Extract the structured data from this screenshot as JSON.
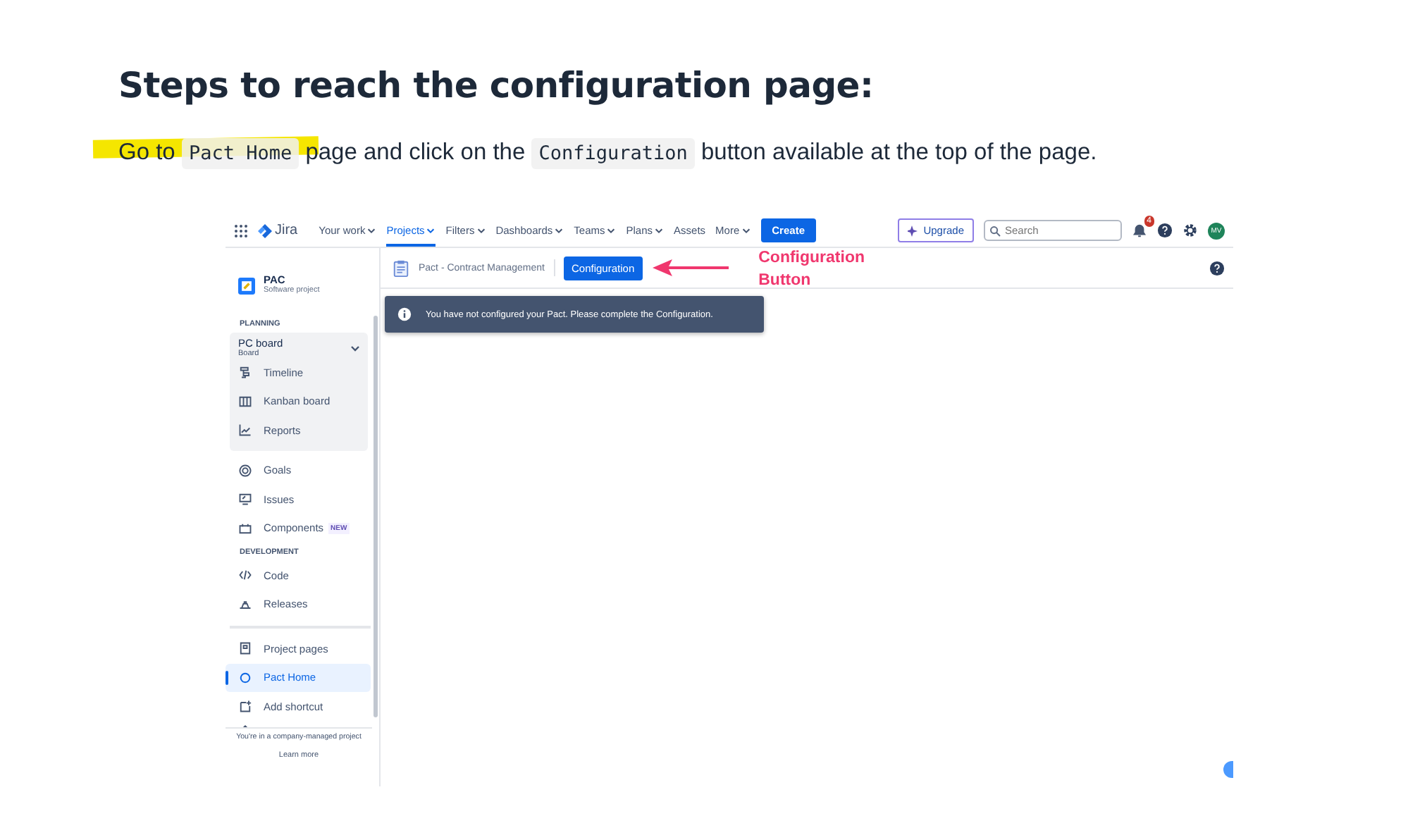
{
  "heading": "Steps to reach the configuration page:",
  "instruction": [
    {
      "kind": "text",
      "text": "Go to "
    },
    {
      "kind": "code",
      "text": "Pact Home"
    },
    {
      "kind": "text",
      "text": " page and click on the "
    },
    {
      "kind": "code",
      "text": "Configuration"
    },
    {
      "kind": "text",
      "text": " button available at the top of the page."
    }
  ],
  "screenshot": {
    "nav": {
      "logo": "Jira",
      "items": [
        {
          "label": "Your work",
          "dropdown": true,
          "selected": false
        },
        {
          "label": "Projects",
          "dropdown": true,
          "selected": true
        },
        {
          "label": "Filters",
          "dropdown": true,
          "selected": false
        },
        {
          "label": "Dashboards",
          "dropdown": true,
          "selected": false
        },
        {
          "label": "Teams",
          "dropdown": true,
          "selected": false
        },
        {
          "label": "Plans",
          "dropdown": true,
          "selected": false
        },
        {
          "label": "Assets",
          "dropdown": false,
          "selected": false
        },
        {
          "label": "More",
          "dropdown": true,
          "selected": false
        }
      ],
      "create": "Create",
      "upgrade": "Upgrade",
      "search": {
        "placeholder": "Search"
      },
      "notifications": "4",
      "avatar": "MV"
    },
    "project": {
      "name": "PAC",
      "type": "Software project"
    },
    "sidebar": [
      {
        "kind": "section",
        "label": "PLANNING"
      },
      {
        "kind": "group",
        "title": "PC board",
        "subtitle": "Board",
        "expanded": true,
        "children": [
          {
            "label": "Timeline",
            "selected": false
          },
          {
            "label": "Kanban board",
            "selected": false
          },
          {
            "label": "Reports",
            "selected": false
          }
        ]
      },
      {
        "kind": "item",
        "label": "Goals",
        "selected": false
      },
      {
        "kind": "item",
        "label": "Issues",
        "selected": false
      },
      {
        "kind": "item",
        "label": "Components",
        "badge": "NEW",
        "selected": false
      },
      {
        "kind": "section",
        "label": "DEVELOPMENT"
      },
      {
        "kind": "item",
        "label": "Code",
        "selected": false
      },
      {
        "kind": "item",
        "label": "Releases",
        "selected": false
      },
      {
        "kind": "divider"
      },
      {
        "kind": "item",
        "label": "Project pages",
        "selected": false
      },
      {
        "kind": "item",
        "label": "Pact Home",
        "selected": true
      },
      {
        "kind": "item",
        "label": "Add shortcut",
        "selected": false
      }
    ],
    "sidebar_footer": {
      "note": "You're in a company-managed project",
      "link": "Learn more"
    },
    "breadcrumb": "Pact - Contract Management",
    "config_button": "Configuration",
    "annotation": "Configuration Button",
    "banner": "You have not configured your Pact. Please complete the Configuration."
  }
}
